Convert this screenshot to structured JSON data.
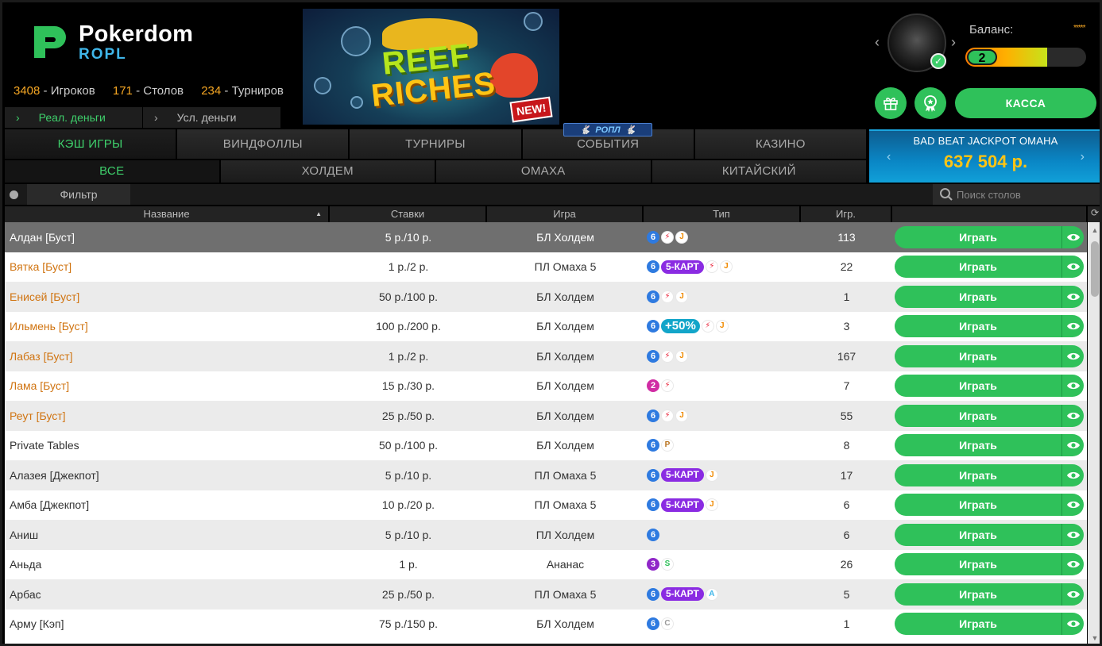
{
  "brand": {
    "name": "Pokerdom",
    "sub": "ROPL"
  },
  "stats": [
    {
      "value": "3408",
      "label": "Игроков"
    },
    {
      "value": "171",
      "label": "Столов"
    },
    {
      "value": "234",
      "label": "Турниров"
    }
  ],
  "money_tabs": [
    "Реал. деньги",
    "Усл. деньги"
  ],
  "banner": {
    "line1": "REEF",
    "line2": "RICHES",
    "badge": "NEW!"
  },
  "roll_badge": "РОПЛ",
  "account": {
    "balance_label": "Баланс:",
    "stars": "*****",
    "level": "2",
    "level_progress": 0.68,
    "cashier": "КАССА"
  },
  "main_tabs": [
    "КЭШ ИГРЫ",
    "ВИНДФОЛЛЫ",
    "ТУРНИРЫ",
    "СОБЫТИЯ",
    "КАЗИНО"
  ],
  "sub_tabs": [
    "ВСЕ",
    "ХОЛДЕМ",
    "ОМАХА",
    "КИТАЙСКИЙ"
  ],
  "jackpot": {
    "title": "BAD BEAT JACKPOT OMAHA",
    "value": "637 504 р."
  },
  "filter": {
    "label": "Фильтр",
    "search_placeholder": "Поиск столов"
  },
  "columns": [
    "Название",
    "Ставки",
    "Игра",
    "Тип",
    "Игр."
  ],
  "play_label": "Играть",
  "rows": [
    {
      "name": "Алдан [Буст]",
      "stake": "5 р./10 р.",
      "game": "БЛ Холдем",
      "players": "113",
      "orange": false,
      "badges": [
        "6",
        "flash",
        "J"
      ]
    },
    {
      "name": "Вятка [Буст]",
      "stake": "1 р./2 р.",
      "game": "ПЛ Омаха 5",
      "players": "22",
      "orange": true,
      "badges": [
        "6",
        "5-КАРТ",
        "flash",
        "J"
      ]
    },
    {
      "name": "Енисей [Буст]",
      "stake": "50 р./100 р.",
      "game": "БЛ Холдем",
      "players": "1",
      "orange": true,
      "badges": [
        "6",
        "flash",
        "J"
      ]
    },
    {
      "name": "Ильмень [Буст]",
      "stake": "100 р./200 р.",
      "game": "БЛ Холдем",
      "players": "3",
      "orange": true,
      "badges": [
        "6",
        "+50%",
        "flash",
        "J"
      ]
    },
    {
      "name": "Лабаз [Буст]",
      "stake": "1 р./2 р.",
      "game": "БЛ Холдем",
      "players": "167",
      "orange": true,
      "badges": [
        "6",
        "flash",
        "J"
      ]
    },
    {
      "name": "Лама [Буст]",
      "stake": "15 р./30 р.",
      "game": "БЛ Холдем",
      "players": "7",
      "orange": true,
      "badges": [
        "2",
        "flash"
      ]
    },
    {
      "name": "Реут [Буст]",
      "stake": "25 р./50 р.",
      "game": "БЛ Холдем",
      "players": "55",
      "orange": true,
      "badges": [
        "6",
        "flash",
        "J"
      ]
    },
    {
      "name": "Private Tables",
      "stake": "50 р./100 р.",
      "game": "БЛ Холдем",
      "players": "8",
      "orange": false,
      "badges": [
        "6",
        "P"
      ]
    },
    {
      "name": "Алазея [Джекпот]",
      "stake": "5 р./10 р.",
      "game": "ПЛ Омаха 5",
      "players": "17",
      "orange": false,
      "badges": [
        "6",
        "5-КАРТ",
        "J"
      ]
    },
    {
      "name": "Амба [Джекпот]",
      "stake": "10 р./20 р.",
      "game": "ПЛ Омаха 5",
      "players": "6",
      "orange": false,
      "badges": [
        "6",
        "5-КАРТ",
        "J"
      ]
    },
    {
      "name": "Аниш",
      "stake": "5 р./10 р.",
      "game": "ПЛ Холдем",
      "players": "6",
      "orange": false,
      "badges": [
        "6"
      ]
    },
    {
      "name": "Аньда",
      "stake": "1 р.",
      "game": "Ананас",
      "players": "26",
      "orange": false,
      "badges": [
        "3",
        "S"
      ]
    },
    {
      "name": "Арбас",
      "stake": "25 р./50 р.",
      "game": "ПЛ Омаха 5",
      "players": "5",
      "orange": false,
      "badges": [
        "6",
        "5-КАРТ",
        "A"
      ]
    },
    {
      "name": "Арму [Кэп]",
      "stake": "75 р./150 р.",
      "game": "БЛ Холдем",
      "players": "1",
      "orange": false,
      "badges": [
        "6",
        "C"
      ]
    }
  ]
}
